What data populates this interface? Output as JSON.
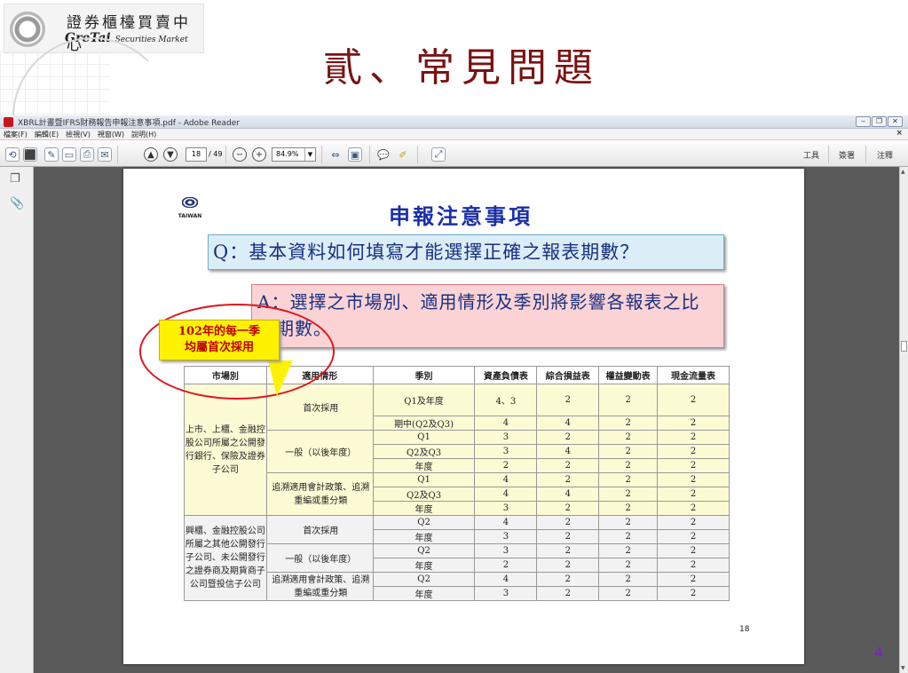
{
  "slide": {
    "logo_cn": "證券櫃檯買賣中心",
    "logo_en_main": "GreTai",
    "logo_en_sub": "Securities Market",
    "title": "貳、常見問題",
    "number": "4"
  },
  "window": {
    "title": "XBRL計畫暨IFRS財務報告申報注意事項.pdf - Adobe Reader",
    "buttons": [
      "‒",
      "❐",
      "✕"
    ]
  },
  "menu": [
    "檔案(F)",
    "編輯(E)",
    "檢視(V)",
    "視窗(W)",
    "說明(H)"
  ],
  "toolbar": {
    "page_current": "18",
    "page_total": "/ 49",
    "zoom": "84.9%",
    "right": [
      "工具",
      "簽署",
      "注釋"
    ]
  },
  "document": {
    "logo_text": "TAIWAN",
    "title": "申報注意事項",
    "question": "Q：基本資料如何填寫才能選擇正確之報表期數？",
    "answer": "A：選擇之市場別、適用情形及季別將影響各報表之比較期數。",
    "callout": [
      "102年的每一季",
      "均屬首次採用"
    ],
    "page_number": "18",
    "table": {
      "headers": [
        "市場別",
        "適用情形",
        "季別",
        "資產負債表",
        "綜合損益表",
        "權益變動表",
        "現金流量表"
      ],
      "group1_market": "上市、上櫃、金融控股公司所屬之公開發行銀行、保險及證券子公司",
      "group1": [
        {
          "case": "首次採用",
          "rows": [
            [
              "Q1及年度",
              "4、3",
              "2",
              "2",
              "2"
            ],
            [
              "期中(Q2及Q3)",
              "4",
              "4",
              "2",
              "2"
            ]
          ]
        },
        {
          "case": "一般（以後年度）",
          "rows": [
            [
              "Q1",
              "3",
              "2",
              "2",
              "2"
            ],
            [
              "Q2及Q3",
              "3",
              "4",
              "2",
              "2"
            ],
            [
              "年度",
              "2",
              "2",
              "2",
              "2"
            ]
          ]
        },
        {
          "case": "追溯適用會計政策、追溯重編或重分類",
          "rows": [
            [
              "Q1",
              "4",
              "2",
              "2",
              "2"
            ],
            [
              "Q2及Q3",
              "4",
              "4",
              "2",
              "2"
            ],
            [
              "年度",
              "3",
              "2",
              "2",
              "2"
            ]
          ]
        }
      ],
      "group2_market": "興櫃、金融控股公司所屬之其他公開發行子公司、未公開發行之證券商及期貨商子公司暨投信子公司",
      "group2": [
        {
          "case": "首次採用",
          "rows": [
            [
              "Q2",
              "4",
              "2",
              "2",
              "2"
            ],
            [
              "年度",
              "3",
              "2",
              "2",
              "2"
            ]
          ]
        },
        {
          "case": "一般（以後年度）",
          "rows": [
            [
              "Q2",
              "3",
              "2",
              "2",
              "2"
            ],
            [
              "年度",
              "2",
              "2",
              "2",
              "2"
            ]
          ]
        },
        {
          "case": "追溯適用會計政策、追溯重編或重分類",
          "rows": [
            [
              "Q2",
              "4",
              "2",
              "2",
              "2"
            ],
            [
              "年度",
              "3",
              "2",
              "2",
              "2"
            ]
          ]
        }
      ]
    }
  }
}
